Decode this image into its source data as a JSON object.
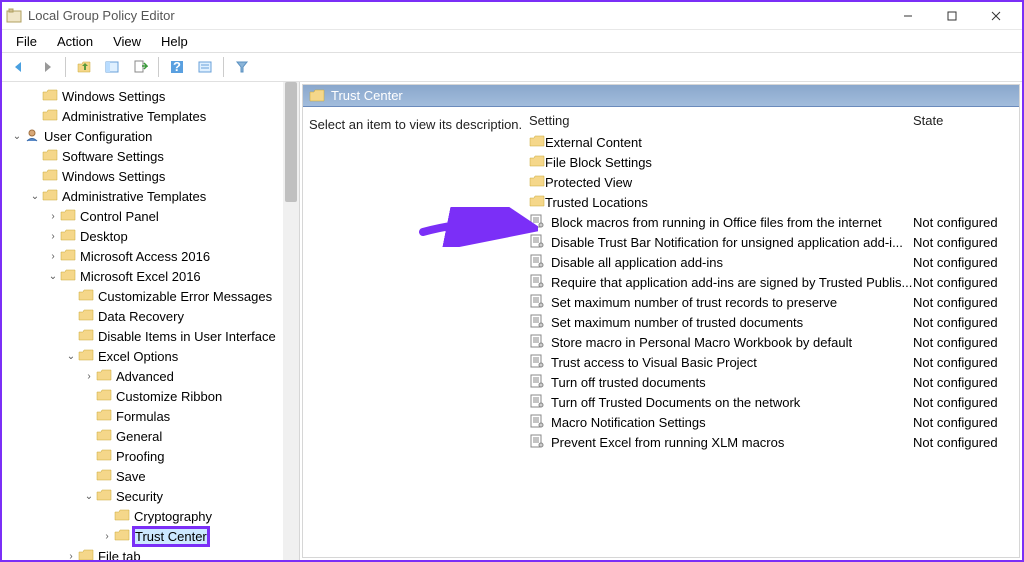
{
  "titlebar": {
    "title": "Local Group Policy Editor"
  },
  "menubar": [
    "File",
    "Action",
    "View",
    "Help"
  ],
  "tree": [
    {
      "indent": 1,
      "twisty": "",
      "label": "Windows Settings",
      "icon": "folder"
    },
    {
      "indent": 1,
      "twisty": "",
      "label": "Administrative Templates",
      "icon": "folder"
    },
    {
      "indent": 0,
      "twisty": "v",
      "label": "User Configuration",
      "icon": "user"
    },
    {
      "indent": 1,
      "twisty": "",
      "label": "Software Settings",
      "icon": "folder"
    },
    {
      "indent": 1,
      "twisty": "",
      "label": "Windows Settings",
      "icon": "folder"
    },
    {
      "indent": 1,
      "twisty": "v",
      "label": "Administrative Templates",
      "icon": "folder"
    },
    {
      "indent": 2,
      "twisty": ">",
      "label": "Control Panel",
      "icon": "folder"
    },
    {
      "indent": 2,
      "twisty": ">",
      "label": "Desktop",
      "icon": "folder"
    },
    {
      "indent": 2,
      "twisty": ">",
      "label": "Microsoft Access 2016",
      "icon": "folder"
    },
    {
      "indent": 2,
      "twisty": "v",
      "label": "Microsoft Excel 2016",
      "icon": "folder"
    },
    {
      "indent": 3,
      "twisty": "",
      "label": "Customizable Error Messages",
      "icon": "folder"
    },
    {
      "indent": 3,
      "twisty": "",
      "label": "Data Recovery",
      "icon": "folder"
    },
    {
      "indent": 3,
      "twisty": "",
      "label": "Disable Items in User Interface",
      "icon": "folder"
    },
    {
      "indent": 3,
      "twisty": "v",
      "label": "Excel Options",
      "icon": "folder"
    },
    {
      "indent": 4,
      "twisty": ">",
      "label": "Advanced",
      "icon": "folder"
    },
    {
      "indent": 4,
      "twisty": "",
      "label": "Customize Ribbon",
      "icon": "folder"
    },
    {
      "indent": 4,
      "twisty": "",
      "label": "Formulas",
      "icon": "folder"
    },
    {
      "indent": 4,
      "twisty": "",
      "label": "General",
      "icon": "folder"
    },
    {
      "indent": 4,
      "twisty": "",
      "label": "Proofing",
      "icon": "folder"
    },
    {
      "indent": 4,
      "twisty": "",
      "label": "Save",
      "icon": "folder"
    },
    {
      "indent": 4,
      "twisty": "v",
      "label": "Security",
      "icon": "folder"
    },
    {
      "indent": 5,
      "twisty": "",
      "label": "Cryptography",
      "icon": "folder"
    },
    {
      "indent": 5,
      "twisty": ">",
      "label": "Trust Center",
      "icon": "folder",
      "selected": true
    },
    {
      "indent": 3,
      "twisty": ">",
      "label": "File tab",
      "icon": "folder"
    }
  ],
  "right": {
    "title": "Trust Center",
    "description": "Select an item to view its description.",
    "columns": {
      "setting": "Setting",
      "state": "State"
    },
    "rows": [
      {
        "icon": "folder",
        "name": "External Content",
        "state": ""
      },
      {
        "icon": "folder",
        "name": "File Block Settings",
        "state": ""
      },
      {
        "icon": "folder",
        "name": "Protected View",
        "state": ""
      },
      {
        "icon": "folder",
        "name": "Trusted Locations",
        "state": ""
      },
      {
        "icon": "setting",
        "name": "Block macros from running in Office files from the internet",
        "state": "Not configured"
      },
      {
        "icon": "setting",
        "name": "Disable Trust Bar Notification for unsigned application add-i...",
        "state": "Not configured"
      },
      {
        "icon": "setting",
        "name": "Disable all application add-ins",
        "state": "Not configured"
      },
      {
        "icon": "setting",
        "name": "Require that application add-ins are signed by Trusted Publis...",
        "state": "Not configured"
      },
      {
        "icon": "setting",
        "name": "Set maximum number of trust records to preserve",
        "state": "Not configured"
      },
      {
        "icon": "setting",
        "name": "Set maximum number of trusted documents",
        "state": "Not configured"
      },
      {
        "icon": "setting",
        "name": "Store macro in Personal Macro Workbook by default",
        "state": "Not configured"
      },
      {
        "icon": "setting",
        "name": "Trust access to Visual Basic Project",
        "state": "Not configured"
      },
      {
        "icon": "setting",
        "name": "Turn off trusted documents",
        "state": "Not configured"
      },
      {
        "icon": "setting",
        "name": "Turn off Trusted Documents on the network",
        "state": "Not configured"
      },
      {
        "icon": "setting",
        "name": "Macro Notification Settings",
        "state": "Not configured"
      },
      {
        "icon": "setting",
        "name": "Prevent Excel from running XLM macros",
        "state": "Not configured"
      }
    ]
  }
}
